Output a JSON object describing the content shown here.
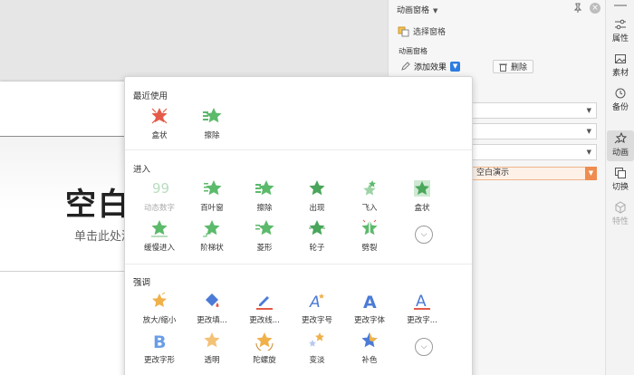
{
  "slide": {
    "title": "空白",
    "subtitle": "单击此处添"
  },
  "pane": {
    "title": "动画窗格",
    "select_pane": "选择窗格",
    "subtitle": "动画窗格",
    "add_effect": "添加效果",
    "delete": "删除",
    "anim_item": "空白演示"
  },
  "sidebar": {
    "items": [
      {
        "label": "属性"
      },
      {
        "label": "素材"
      },
      {
        "label": "备份"
      },
      {
        "label": "动画"
      },
      {
        "label": "切换"
      },
      {
        "label": "特性"
      }
    ]
  },
  "popup": {
    "recent": {
      "title": "最近使用",
      "items": [
        {
          "label": "盒状"
        },
        {
          "label": "擦除"
        }
      ]
    },
    "entrance": {
      "title": "进入",
      "items": [
        {
          "label": "动态数字"
        },
        {
          "label": "百叶窗"
        },
        {
          "label": "擦除"
        },
        {
          "label": "出现"
        },
        {
          "label": "飞入"
        },
        {
          "label": "盒状"
        },
        {
          "label": "缓慢进入"
        },
        {
          "label": "阶梯状"
        },
        {
          "label": "菱形"
        },
        {
          "label": "轮子"
        },
        {
          "label": "劈裂"
        }
      ]
    },
    "emphasis": {
      "title": "强调",
      "items": [
        {
          "label": "放大/缩小"
        },
        {
          "label": "更改填..."
        },
        {
          "label": "更改线..."
        },
        {
          "label": "更改字号"
        },
        {
          "label": "更改字体"
        },
        {
          "label": "更改字..."
        },
        {
          "label": "更改字形"
        },
        {
          "label": "透明"
        },
        {
          "label": "陀螺旋"
        },
        {
          "label": "变淡"
        },
        {
          "label": "补色"
        }
      ]
    }
  },
  "colors": {
    "accent_blue": "#2e7ce0",
    "accent_orange": "#ee8d4f",
    "star_green": "#5cba6b",
    "star_orange": "#f0b14a"
  }
}
